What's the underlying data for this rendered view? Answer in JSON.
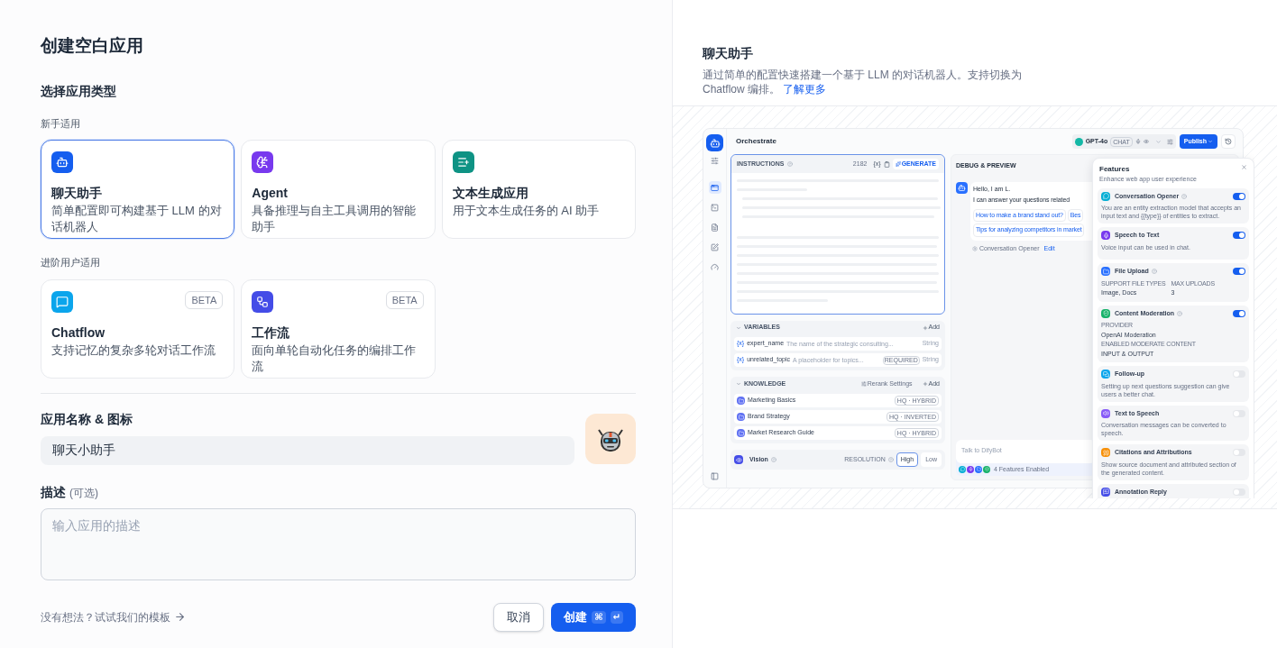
{
  "form": {
    "title": "创建空白应用",
    "type_heading": "选择应用类型",
    "groups": [
      {
        "label": "新手适用",
        "types": [
          {
            "kind": "chat",
            "color": "#155eef",
            "title": "聊天助手",
            "description": "简单配置即可构建基于 LLM 的对话机器人",
            "selected": true
          },
          {
            "kind": "agent",
            "color": "#7839ee",
            "title": "Agent",
            "description": "具备推理与自主工具调用的智能助手",
            "selected": false
          },
          {
            "kind": "text",
            "color": "#0e9384",
            "title": "文本生成应用",
            "description": "用于文本生成任务的 AI 助手",
            "selected": false
          }
        ]
      },
      {
        "label": "进阶用户适用",
        "types": [
          {
            "kind": "chatflow",
            "color": "#0ba5ec",
            "title": "Chatflow",
            "description": "支持记忆的复杂多轮对话工作流",
            "badge": "BETA",
            "selected": false
          },
          {
            "kind": "workflow",
            "color": "#444ce7",
            "title": "工作流",
            "description": "面向单轮自动化任务的编排工作流",
            "badge": "BETA",
            "selected": false
          }
        ]
      }
    ],
    "name_field": {
      "label": "应用名称 & 图标",
      "value": "聊天小助手"
    },
    "description_field": {
      "label": "描述",
      "hint": "(可选)",
      "placeholder": "输入应用的描述"
    },
    "template_link": "没有想法？试试我们的模板",
    "cancel": "取消",
    "create": "创建",
    "shortcut_keys": [
      "⌘",
      "↵"
    ]
  },
  "preview": {
    "title": "聊天助手",
    "description": "通过简单的配置快速搭建一个基于 LLM 的对话机器人。支持切换为 Chatflow 编排。",
    "link": "了解更多"
  },
  "mockup": {
    "header_title": "Orchestrate",
    "rail": [
      {
        "selected": true
      },
      {
        "selected": false
      },
      {
        "selected": false
      },
      {
        "selected": false
      },
      {
        "selected": false
      }
    ],
    "model": {
      "name": "GPT-4o",
      "tag": "CHAT"
    },
    "publish": "Publish",
    "instructions": {
      "label": "INSTRUCTIONS",
      "count": "2182",
      "var_token": "{x}",
      "generate": "GENERATE"
    },
    "variables": {
      "label": "VARIABLES",
      "add": "Add",
      "items": [
        {
          "token": "{x}",
          "name": "expert_name",
          "description": "The name of the strategic consulting...",
          "type": "String"
        },
        {
          "token": "{x}",
          "name": "unrelated_topic",
          "description": "A placeholder for topics...",
          "badge": "REQUIRED",
          "type": "String"
        }
      ]
    },
    "knowledge": {
      "label": "KNOWLEDGE",
      "rerank": "Rerank Settings",
      "add": "Add",
      "items": [
        {
          "name": "Marketing Basics",
          "tag": "HQ · HYBRID"
        },
        {
          "name": "Brand Strategy",
          "tag": "HQ · INVERTED"
        },
        {
          "name": "Market Research Guide",
          "tag": "HQ · HYBRID"
        }
      ]
    },
    "vision": {
      "label": "Vision",
      "resolution_label": "RESOLUTION",
      "options": [
        {
          "label": "High",
          "selected": true
        },
        {
          "label": "Low",
          "selected": false
        }
      ]
    },
    "debug": {
      "label": "DEBUG & PREVIEW",
      "greeting": "Hello, I am L.",
      "intro": "I can answer your questions related",
      "suggestions": [
        "How to make a brand stand out?",
        "Bes",
        "Tips for analyzing competitors in market"
      ],
      "opener_label": "Conversation Opener",
      "edit": "Edit",
      "input_placeholder": "Talk to DifyBot",
      "features_enabled": "4 Features Enabled"
    },
    "features": {
      "title": "Features",
      "subtitle": "Enhance web app user experience",
      "items": [
        {
          "kind": "opener",
          "color": "#06aed4",
          "title": "Conversation Opener",
          "help": true,
          "on": true,
          "description": "You are an entity extraction model that accepts an input text and {{type}} of entities to extract."
        },
        {
          "kind": "speech",
          "color": "#7839ee",
          "title": "Speech to Text",
          "help": false,
          "on": true,
          "description": "Voice input can be used in chat."
        },
        {
          "kind": "upload",
          "color": "#2970ff",
          "title": "File Upload",
          "help": true,
          "on": true,
          "fields": [
            {
              "label": "SUPPORT FILE TYPES",
              "value": "Image, Docs"
            },
            {
              "label": "MAX UPLOADS",
              "value": "3"
            }
          ]
        },
        {
          "kind": "moderation",
          "color": "#17b26a",
          "title": "Content Moderation",
          "help": true,
          "on": true,
          "fields": [
            {
              "label": "PROVIDER",
              "value": "OpenAI Moderation"
            },
            {
              "label": "ENABLED MODERATE CONTENT",
              "value": "INPUT & OUTPUT"
            }
          ]
        },
        {
          "kind": "followup",
          "color": "#0ba5ec",
          "title": "Follow-up",
          "help": false,
          "on": false,
          "description": "Setting up next questions suggestion can give users a better chat."
        },
        {
          "kind": "tts",
          "color": "#875bf7",
          "title": "Text to Speech",
          "help": false,
          "on": false,
          "description": "Conversation messages can be converted to speech."
        },
        {
          "kind": "citation",
          "color": "#f79009",
          "title": "Citations and Attributions",
          "help": false,
          "on": false,
          "description": "Show source document and attributed section of the generated content."
        },
        {
          "kind": "annotation",
          "color": "#444ce7",
          "title": "Annotation Reply",
          "help": false,
          "on": false
        }
      ]
    }
  }
}
